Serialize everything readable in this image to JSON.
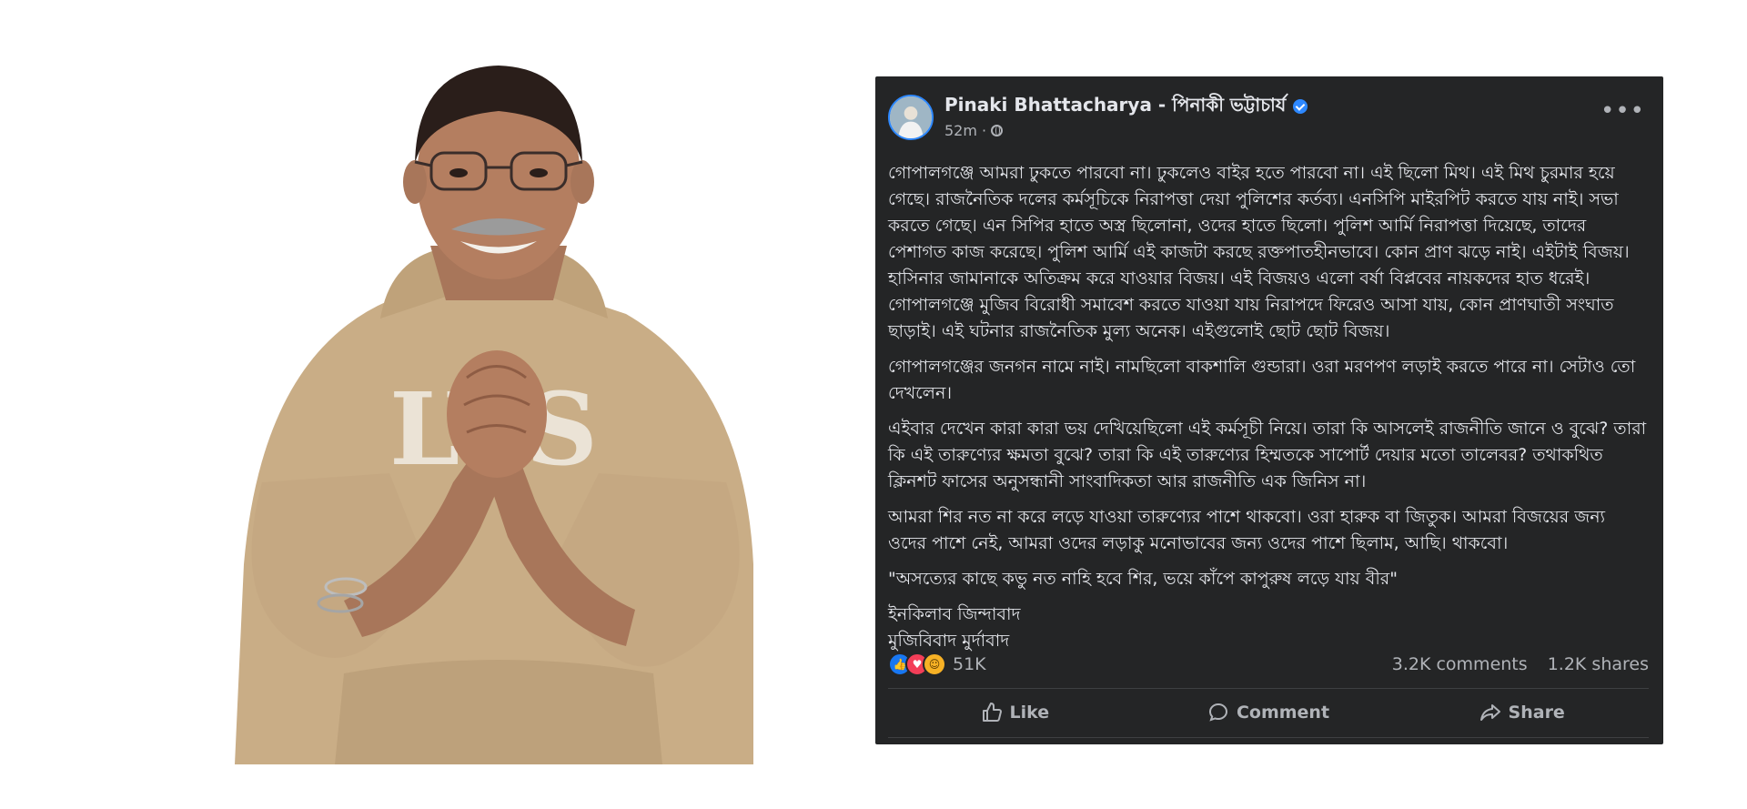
{
  "post": {
    "author": "Pinaki Bhattacharya - পিনাকী ভট্টাচার্য",
    "time": "52m ·",
    "paragraphs": [
      "গোপালগঞ্জে আমরা ঢুকতে পারবো না। ঢুকলেও বাইর হতে পারবো না। এই ছিলো মিথ। এই মিথ চুরমার হয়ে গেছে। রাজনৈতিক দলের কর্মসূচিকে নিরাপত্তা দেয়া পুলিশের কর্তব্য। এনসিপি মাইরপিট করতে যায় নাই। সভা করতে গেছে। এন সিপির হাতে অস্ত্র ছিলোনা, ওদের হাতে ছিলো। পুলিশ আর্মি নিরাপত্তা দিয়েছে, তাদের পেশাগত কাজ করেছে। পুলিশ আর্মি এই কাজটা করছে রক্তপাতহীনভাবে। কোন প্রাণ ঝড়ে নাই। এইটাই বিজয়। হাসিনার জামানাকে অতিক্রম করে যাওয়ার বিজয়। এই বিজয়ও এলো বর্ষা বিপ্লবের নায়কদের হাত ধরেই। গোপালগঞ্জে মুজিব বিরোধী সমাবেশ করতে যাওয়া যায় নিরাপদে ফিরেও আসা যায়, কোন প্রাণঘাতী সংঘাত ছাড়াই। এই ঘটনার রাজনৈতিক মুল্য অনেক। এইগুলোই ছোট ছোট বিজয়।",
      "গোপালগঞ্জের জনগন নামে নাই। নামছিলো বাকশালি গুন্ডারা। ওরা মরণপণ লড়াই করতে পারে না। সেটাও তো দেখলেন।",
      "এইবার দেখেন কারা কারা ভয় দেখিয়েছিলো এই কর্মসূচী নিয়ে। তারা কি আসলেই রাজনীতি জানে ও বুঝে? তারা কি এই তারুণ্যের ক্ষমতা বুঝে? তারা কি এই তারুণ্যের হিম্মতকে সাপোর্ট দেয়ার মতো তালেবর? তথাকথিত ক্লিনশট ফাসের অনুসন্ধানী সাংবাদিকতা আর রাজনীতি এক জিনিস না।",
      "আমরা শির নত না করে লড়ে যাওয়া তারুণ্যের পাশে থাকবো। ওরা হারুক বা জিতুক। আমরা বিজয়ের জন্য ওদের পাশে নেই, আমরা ওদের লড়াকু মনোভাবের জন্য ওদের পাশে ছিলাম, আছি। থাকবো।",
      "\"অসত্যের কাছে কভু নত নাহি হবে শির, ভয়ে কাঁপে কাপুরুষ লড়ে যায় বীর\""
    ],
    "closing_line_1": "ইনকিলাব জিন্দাবাদ",
    "closing_line_2": "মুজিবিবাদ মুর্দাবাদ",
    "reaction_count": "51K",
    "comments": "3.2K comments",
    "shares": "1.2K shares",
    "actions": {
      "like": "Like",
      "comment": "Comment",
      "share": "Share"
    }
  },
  "colors": {
    "card_background": "#242526",
    "primary_text": "#e4e6eb",
    "secondary_text": "#b0b3b8",
    "verified_badge": "#2d88ff",
    "like_reaction": "#1877f2",
    "love_reaction": "#f33e58",
    "haha_reaction": "#f7b125"
  },
  "icons": [
    "verified-icon",
    "globe-icon",
    "more-icon",
    "like-reaction-icon",
    "love-reaction-icon",
    "haha-reaction-icon",
    "thumbs-up-icon",
    "comment-icon",
    "share-icon"
  ]
}
